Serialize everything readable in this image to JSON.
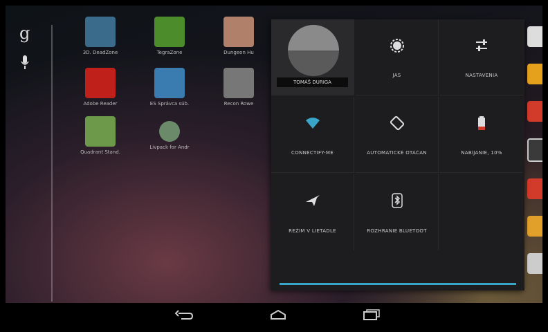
{
  "launcher": {
    "google_letter": "g",
    "apps": [
      {
        "label": "3D. DeadZone",
        "color": "#3a6b8a"
      },
      {
        "label": "TegraZone",
        "color": "#4c8c2a"
      },
      {
        "label": "Dungeon Hu",
        "color": "#b0806a"
      },
      {
        "label": "Adobe Reader",
        "color": "#c0201a"
      },
      {
        "label": "ES Správca súb.",
        "color": "#3a7bb0"
      },
      {
        "label": "Recon Rowe",
        "color": "#999999"
      },
      {
        "label": "Quadrant Stand.",
        "color": "#6c9a4a"
      },
      {
        "label": "Livpack for Andr",
        "color": "#6a8a6a"
      }
    ]
  },
  "quick_settings": {
    "user_name": "TOMÁŠ DURIGA",
    "tiles": [
      {
        "label": "JAS",
        "icon": "brightness-icon"
      },
      {
        "label": "NASTAVENIA",
        "icon": "settings-sliders-icon"
      },
      {
        "label": "CONNECTIFY-ME",
        "icon": "wifi-icon"
      },
      {
        "label": "AUTOMATICKÉ OTÁČAN",
        "icon": "rotate-icon"
      },
      {
        "label": "NABÍJANIE, 10%",
        "icon": "battery-icon"
      },
      {
        "label": "REŽIM V LIETADLE",
        "icon": "airplane-icon"
      },
      {
        "label": "ROZHRANIE BLUETOOT",
        "icon": "bluetooth-icon"
      }
    ],
    "accent": "#39a5c9"
  }
}
